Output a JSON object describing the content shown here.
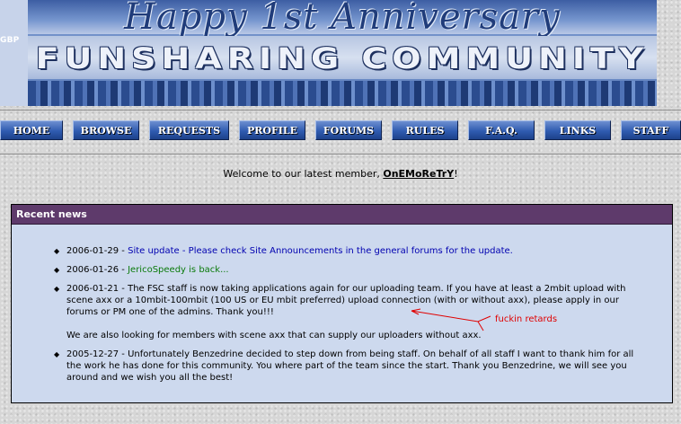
{
  "header": {
    "badge": "GBP",
    "anniversary_text": "Happy 1st Anniversary",
    "site_title": "FUNSHARING COMMUNITY"
  },
  "nav": {
    "items": [
      "HOME",
      "BROWSE",
      "REQUESTS",
      "PROFILE",
      "FORUMS",
      "RULES",
      "F.A.Q.",
      "LINKS",
      "STAFF"
    ]
  },
  "welcome": {
    "prefix": "Welcome to our latest member, ",
    "member": "OnEMoReTrY",
    "suffix": "!"
  },
  "news": {
    "title": "Recent news",
    "items": [
      {
        "date": "2006-01-29 - ",
        "text": "Site update - Please check Site Announcements in the general forums for the update.",
        "color": "#0000b0"
      },
      {
        "date": "2006-01-26 - ",
        "text": "JericoSpeedy is back...",
        "color": "#0a7a0a"
      },
      {
        "date": "2006-01-21 - ",
        "text": "The FSC staff is now taking applications again for our uploading team.  If you have at least a 2mbit upload with scene axx or a 10mbit-100mbit (100 US or EU mbit preferred) upload connection (with or without axx), please apply in our forums or PM one of the admins.  Thank you!!!",
        "extra": "We are also looking for members with scene axx that can supply our uploaders without axx."
      },
      {
        "date": "2005-12-27 - ",
        "text": "Unfortunately Benzedrine decided to step down from being staff. On behalf of all staff I want to thank him for all the work he has done for this community. You where part of the team since the start.  Thank you Benzedrine, we will see you around and we wish you all the best!"
      }
    ]
  },
  "annotation": {
    "text": "fuckin retards",
    "color": "#e00000"
  }
}
